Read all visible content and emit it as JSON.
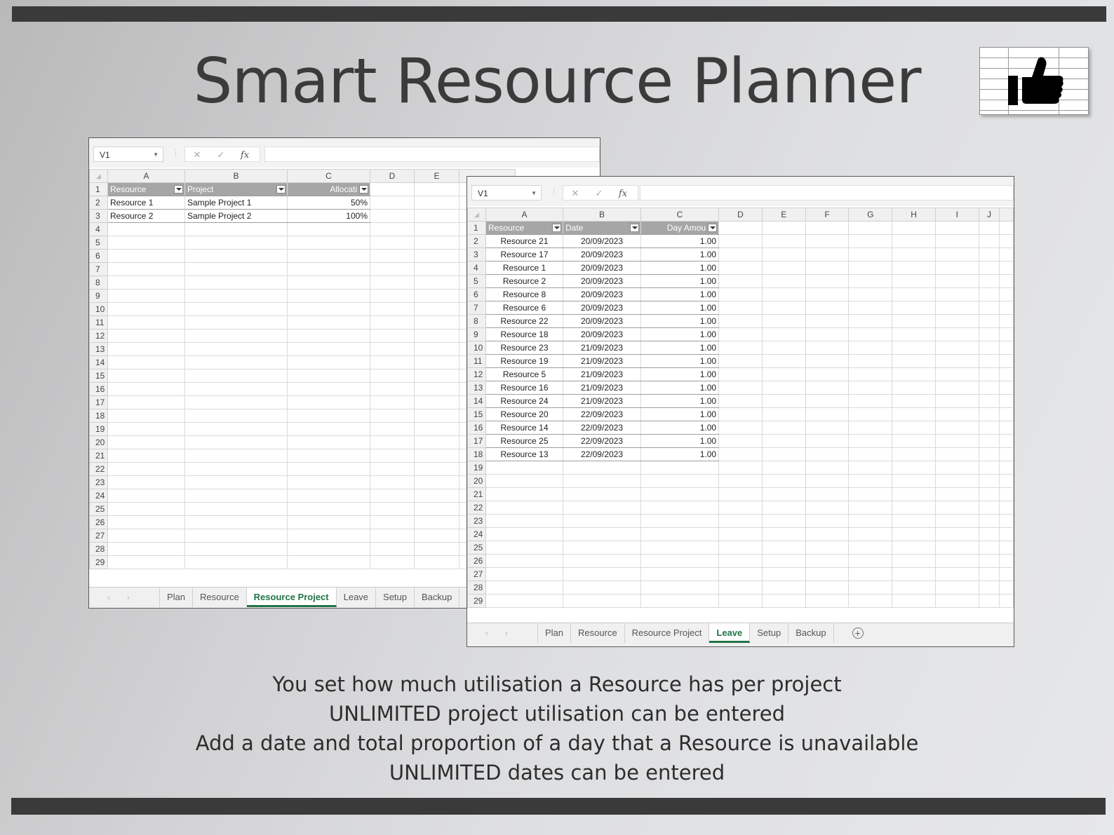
{
  "title": "Smart Resource Planner",
  "caption_lines": [
    "You set how much utilisation a Resource has per project",
    "UNLIMITED project utilisation can be entered",
    "Add a date and total proportion of a day that a Resource is unavailable",
    "UNLIMITED dates can be entered"
  ],
  "win1": {
    "namebox": "V1",
    "columns": [
      "A",
      "B",
      "C",
      "D",
      "E"
    ],
    "headers": [
      "Resource",
      "Project",
      "Allocati"
    ],
    "rows": [
      [
        "Resource 1",
        "Sample Project 1",
        "50%"
      ],
      [
        "Resource 2",
        "Sample Project 2",
        "100%"
      ]
    ],
    "tabs": [
      "Plan",
      "Resource",
      "Resource Project",
      "Leave",
      "Setup",
      "Backup"
    ],
    "active_tab": "Resource Project"
  },
  "win2": {
    "namebox": "V1",
    "columns": [
      "A",
      "B",
      "C",
      "D",
      "E",
      "F",
      "G",
      "H",
      "I",
      "J"
    ],
    "headers": [
      "Resource",
      "Date",
      "Day Amou"
    ],
    "rows": [
      [
        "Resource 21",
        "20/09/2023",
        "1.00"
      ],
      [
        "Resource 17",
        "20/09/2023",
        "1.00"
      ],
      [
        "Resource 1",
        "20/09/2023",
        "1.00"
      ],
      [
        "Resource 2",
        "20/09/2023",
        "1.00"
      ],
      [
        "Resource 8",
        "20/09/2023",
        "1.00"
      ],
      [
        "Resource 6",
        "20/09/2023",
        "1.00"
      ],
      [
        "Resource 22",
        "20/09/2023",
        "1.00"
      ],
      [
        "Resource 18",
        "20/09/2023",
        "1.00"
      ],
      [
        "Resource 23",
        "21/09/2023",
        "1.00"
      ],
      [
        "Resource 19",
        "21/09/2023",
        "1.00"
      ],
      [
        "Resource 5",
        "21/09/2023",
        "1.00"
      ],
      [
        "Resource 16",
        "21/09/2023",
        "1.00"
      ],
      [
        "Resource 24",
        "21/09/2023",
        "1.00"
      ],
      [
        "Resource 20",
        "22/09/2023",
        "1.00"
      ],
      [
        "Resource 14",
        "22/09/2023",
        "1.00"
      ],
      [
        "Resource 25",
        "22/09/2023",
        "1.00"
      ],
      [
        "Resource 13",
        "22/09/2023",
        "1.00"
      ]
    ],
    "tabs": [
      "Plan",
      "Resource",
      "Resource Project",
      "Leave",
      "Setup",
      "Backup"
    ],
    "active_tab": "Leave"
  },
  "colors": {
    "bar": "#3a3a3a",
    "excel_green": "#217346",
    "table_header": "#a6a6a6"
  },
  "icons": {
    "logo": "thumbs-up-icon",
    "cancel": "close-icon",
    "enter": "check-icon",
    "function": "fx-icon",
    "add_sheet": "plus-circle-icon"
  }
}
